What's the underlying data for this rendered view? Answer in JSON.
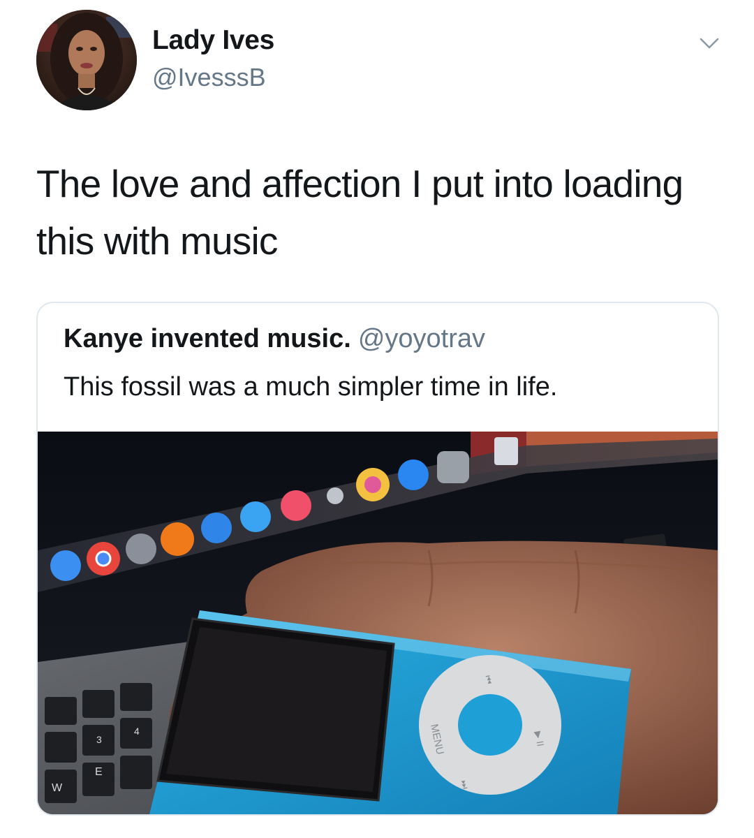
{
  "author": {
    "display_name": "Lady Ives",
    "handle": "@IvesssB"
  },
  "tweet": {
    "text": "The love and affection I put into loading this with music"
  },
  "quoted_tweet": {
    "display_name": "Kanye invented music.",
    "handle": "@yoyotrav",
    "text": "This fossil was a much simpler time in life.",
    "media": {
      "wheel_labels": {
        "menu": "MENU",
        "prev": "⏮",
        "next": "⏭",
        "play": "▶ II"
      },
      "key_labels": [
        "W",
        "E",
        "3",
        "4"
      ]
    }
  },
  "colors": {
    "text": "#14171a",
    "secondary": "#657786",
    "border": "#e1e8ed",
    "ipod_blue": "#1e9fd6"
  }
}
